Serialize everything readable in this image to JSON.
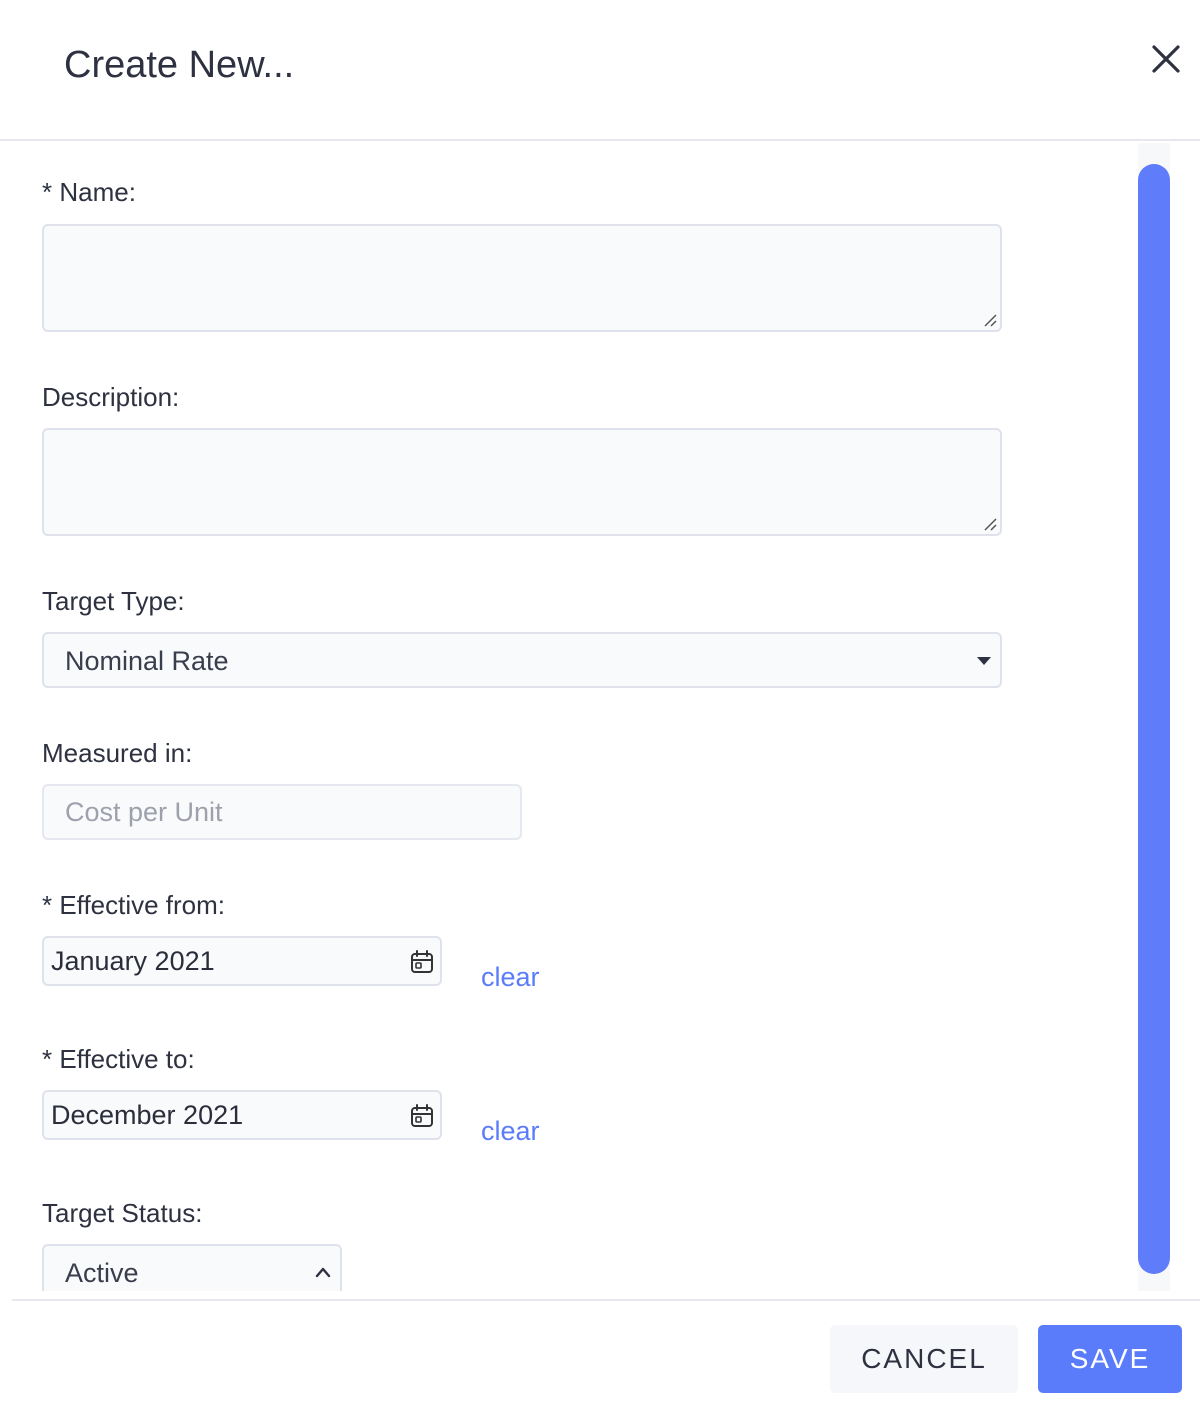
{
  "dialog": {
    "title": "Create New...",
    "close_icon": "close-icon"
  },
  "form": {
    "name": {
      "label": "* Name:",
      "value": ""
    },
    "description": {
      "label": "Description:",
      "value": ""
    },
    "target_type": {
      "label": "Target Type:",
      "selected": "Nominal Rate",
      "icon": "caret-down-icon"
    },
    "measured_in": {
      "label": "Measured in:",
      "value": "Cost per Unit"
    },
    "effective_from": {
      "label": "* Effective from:",
      "value": "January 2021",
      "icon": "calendar-icon",
      "clear_label": "clear"
    },
    "effective_to": {
      "label": "* Effective to:",
      "value": "December 2021",
      "icon": "calendar-icon",
      "clear_label": "clear"
    },
    "target_status": {
      "label": "Target Status:",
      "selected": "Active",
      "icon": "chevron-up-icon"
    }
  },
  "footer": {
    "cancel_label": "CANCEL",
    "save_label": "SAVE"
  },
  "colors": {
    "accent": "#5b7cfa",
    "scroll_thumb": "#5f7cfb",
    "text": "#2e3140",
    "muted_text": "#9ea1ac"
  }
}
